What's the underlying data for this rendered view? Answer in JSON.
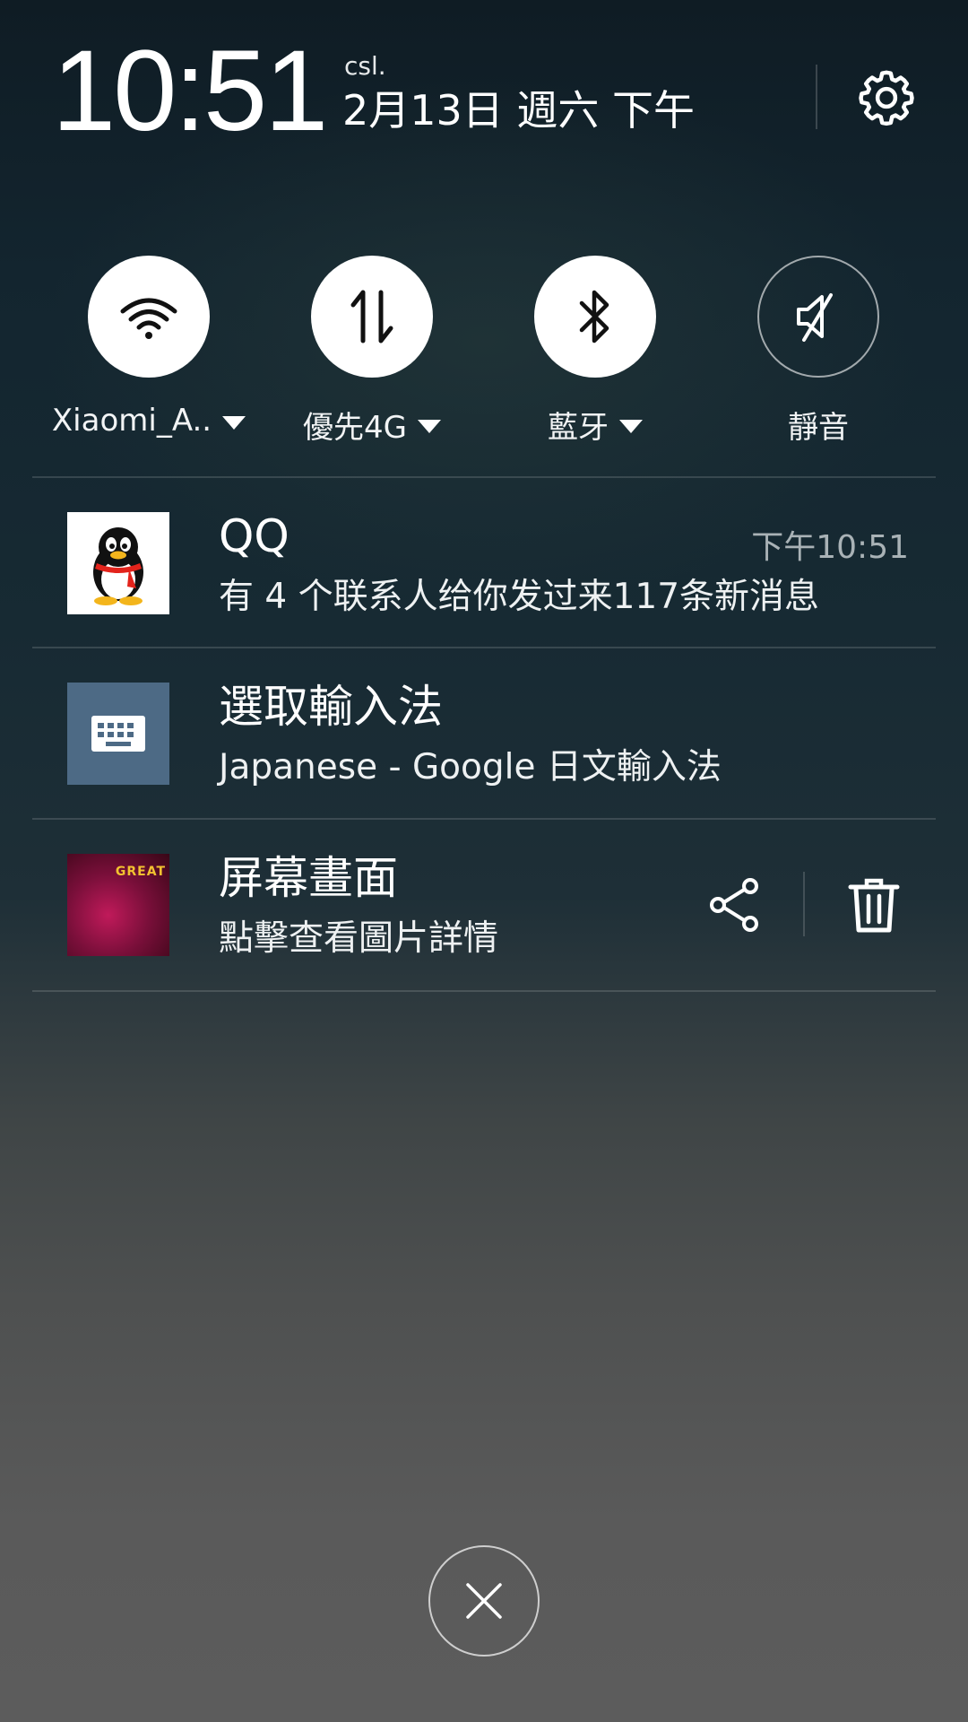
{
  "header": {
    "time": "10:51",
    "carrier": "csl.",
    "date": "2月13日 週六 下午"
  },
  "icons": {
    "settings": "gear-icon",
    "wifi": "wifi-icon",
    "data": "mobile-data-icon",
    "bluetooth": "bluetooth-icon",
    "mute": "speaker-muted-icon",
    "share": "share-icon",
    "delete": "trash-icon",
    "clear": "close-icon"
  },
  "toggles": [
    {
      "label": "Xiaomi_A..",
      "state": "on",
      "has_dropdown": true
    },
    {
      "label": "優先4G",
      "state": "on",
      "has_dropdown": true
    },
    {
      "label": "藍牙",
      "state": "on",
      "has_dropdown": true
    },
    {
      "label": "靜音",
      "state": "off",
      "has_dropdown": false
    }
  ],
  "notifications": [
    {
      "app": "QQ",
      "title": "QQ",
      "text": "有 4 个联系人给你发过来117条新消息",
      "time": "下午10:51"
    },
    {
      "app": "input-method",
      "title": "選取輸入法",
      "text": "Japanese - Google 日文輸入法"
    },
    {
      "app": "screenshot",
      "title": "屏幕畫面",
      "text": "點擊查看圖片詳情",
      "thumbnail_text": "GREAT"
    }
  ],
  "colors": {
    "toggle_on": "#ffffff",
    "keyboard_icon_bg": "#4d6a85",
    "time_text": "#a9b2b6"
  }
}
